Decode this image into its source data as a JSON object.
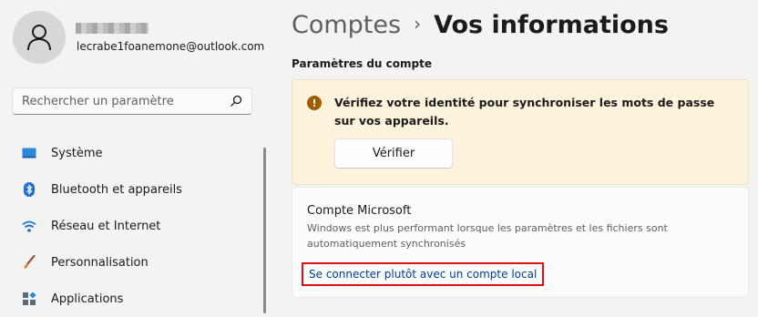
{
  "user": {
    "email": "lecrabe1foanemone@outlook.com"
  },
  "search": {
    "placeholder": "Rechercher un paramètre",
    "icon": "search-icon"
  },
  "nav": {
    "items": [
      {
        "label": "Système",
        "icon": "monitor-icon"
      },
      {
        "label": "Bluetooth et appareils",
        "icon": "bluetooth-icon"
      },
      {
        "label": "Réseau et Internet",
        "icon": "wifi-icon"
      },
      {
        "label": "Personnalisation",
        "icon": "brush-icon"
      },
      {
        "label": "Applications",
        "icon": "apps-icon"
      }
    ]
  },
  "header": {
    "breadcrumb_parent": "Comptes",
    "separator": "›",
    "current": "Vos informations"
  },
  "main": {
    "section_label": "Paramètres du compte",
    "warning": {
      "text": "Vérifiez votre identité pour synchroniser les mots de passe sur vos appareils.",
      "icon_glyph": "!",
      "button_label": "Vérifier",
      "accent": "#9d5d00",
      "background": "#fcf3dc"
    },
    "microsoft_account": {
      "title": "Compte Microsoft",
      "description": "Windows est plus performant lorsque les paramètres et les fichiers sont automatiquement synchronisés",
      "link_label": "Se connecter plutôt avec un compte local",
      "link_color": "#003e92",
      "highlight_color": "#e01010"
    }
  }
}
